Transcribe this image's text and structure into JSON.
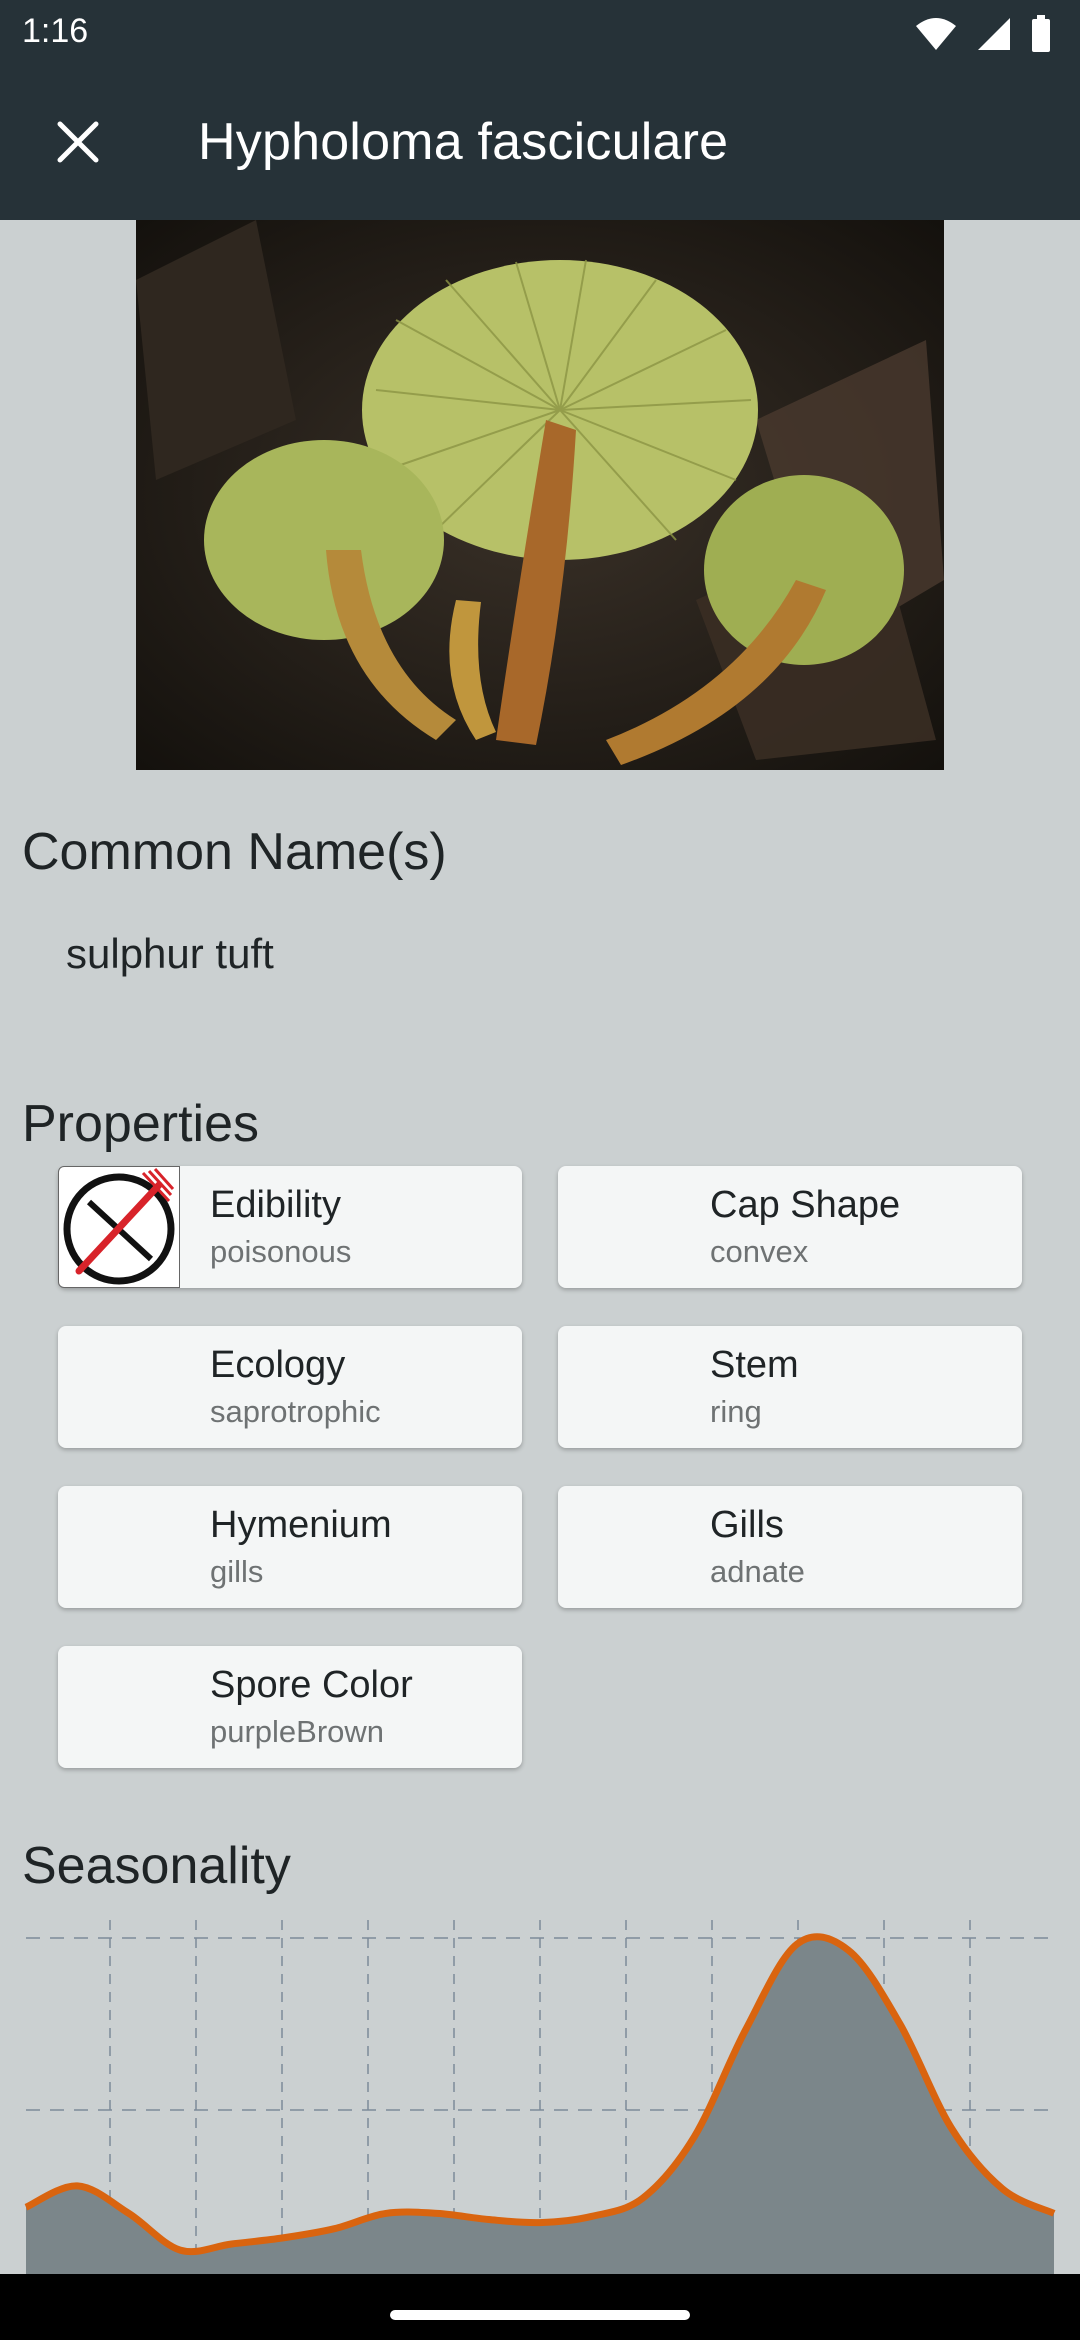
{
  "status_bar": {
    "time": "1:16"
  },
  "app_bar": {
    "title": "Hypholoma fasciculare",
    "close_icon": "close-icon"
  },
  "sections": {
    "common_names_title": "Common Name(s)",
    "properties_title": "Properties",
    "seasonality_title": "Seasonality"
  },
  "common_names": [
    "sulphur tuft"
  ],
  "properties": [
    {
      "title": "Edibility",
      "value": "poisonous",
      "icon": "not-edible-icon"
    },
    {
      "title": "Cap Shape",
      "value": "convex"
    },
    {
      "title": "Ecology",
      "value": "saprotrophic"
    },
    {
      "title": "Stem",
      "value": "ring"
    },
    {
      "title": "Hymenium",
      "value": "gills"
    },
    {
      "title": "Gills",
      "value": "adnate"
    },
    {
      "title": "Spore Color",
      "value": "purpleBrown"
    }
  ],
  "colors": {
    "app_bar": "#263238",
    "background": "#cbd0d1",
    "chart_line": "#d9640f",
    "chart_fill": "#7b868a",
    "grid": "#7d8a99"
  },
  "chart_data": {
    "type": "area",
    "x": [
      0,
      0.5,
      1,
      1.5,
      2,
      2.5,
      3,
      3.5,
      4,
      4.5,
      5,
      5.5,
      6,
      6.5,
      7,
      7.5,
      8,
      8.5,
      9,
      9.5,
      10,
      10.5,
      11,
      11.5,
      12
    ],
    "values": [
      0.12,
      0.19,
      0.1,
      -0.02,
      0.0,
      0.02,
      0.05,
      0.1,
      0.1,
      0.08,
      0.07,
      0.09,
      0.15,
      0.35,
      0.7,
      0.98,
      0.96,
      0.72,
      0.38,
      0.18,
      0.1
    ],
    "ylim": [
      0,
      1
    ],
    "grid": true,
    "title": "",
    "xlabel": "",
    "ylabel": ""
  }
}
